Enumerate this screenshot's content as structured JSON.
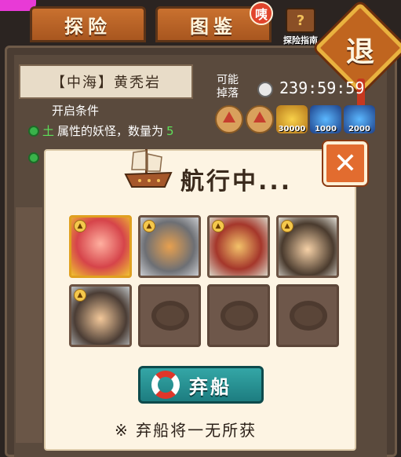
{
  "tabs": [
    {
      "label": "探险"
    },
    {
      "label": "图鉴"
    }
  ],
  "tab_badge": "咦",
  "guide": {
    "label": "探险指南",
    "icon": "book-question-icon"
  },
  "retreat": {
    "label": "退"
  },
  "area": {
    "label": "【中海】黄秃岩"
  },
  "condition": {
    "title": "开启条件",
    "text_prefix": "土",
    "text_body": "属性的妖怪，数量为",
    "count": "5"
  },
  "drops": {
    "label_line1": "可能",
    "label_line2": "掉落",
    "timer": "239:59:59",
    "items": [
      {
        "icon": "medal-icon",
        "amount": ""
      },
      {
        "icon": "sword-medal-icon",
        "amount": ""
      },
      {
        "icon": "gold-pot-icon",
        "amount": "30000"
      },
      {
        "icon": "blue-flame-icon",
        "amount": "1000"
      },
      {
        "icon": "blue-flame-icon",
        "amount": "2000"
      }
    ]
  },
  "dialog": {
    "title": "航行中...",
    "close_label": "✕",
    "abandon_label": "弃船",
    "warning": "※ 弃船将一无所获"
  },
  "colors": {
    "tab": "#c9712f",
    "accent_orange": "#e26c2f",
    "teal_button": "#34a6a6",
    "dialog_bg": "#fdf4e3",
    "condition_green": "#5ee15a"
  }
}
